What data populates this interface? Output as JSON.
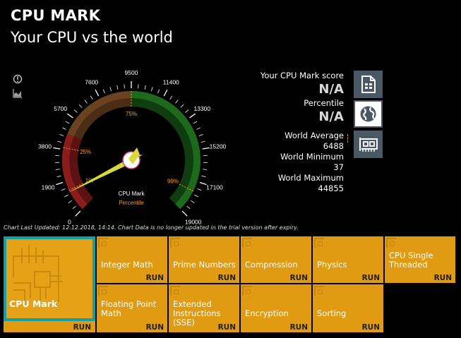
{
  "header": {
    "title": "CPU MARK",
    "subtitle": "Your CPU vs the world"
  },
  "gauge": {
    "min": 0,
    "max": 19000,
    "ticks": [
      0,
      1900,
      3800,
      5700,
      7600,
      9500,
      11400,
      13300,
      15200,
      17100,
      19000
    ],
    "bands": [
      {
        "from": 0,
        "to": 4750,
        "color": "#5c1212"
      },
      {
        "from": 4750,
        "to": 9500,
        "color": "#4a2d14"
      },
      {
        "from": 9500,
        "to": 19000,
        "color": "#0f3d0f"
      }
    ],
    "band_accents": [
      {
        "from": 0,
        "to": 4750,
        "color": "#8a1c1c"
      },
      {
        "from": 4750,
        "to": 9500,
        "color": "#6a4220"
      },
      {
        "from": 9500,
        "to": 19000,
        "color": "#1d6a1d"
      }
    ],
    "percent_markers": [
      {
        "label": "1%",
        "value": 1350
      },
      {
        "label": "25%",
        "value": 3900
      },
      {
        "label": "75%",
        "value": 9500
      },
      {
        "label": "99%",
        "value": 17700
      }
    ],
    "needle_value": 1250,
    "needle_color": "#d8d838",
    "center_label": "CPU Mark",
    "center_sublabel": "Percentile",
    "tick_color": "#ffffff",
    "marker_color": "#f0a020"
  },
  "stats": {
    "score_label": "Your CPU Mark score",
    "score_value": "N/A",
    "percentile_label": "Percentile",
    "percentile_value": "N/A",
    "world_avg_label": "World Average",
    "world_avg_value": "6488",
    "world_min_label": "World Minimum",
    "world_min_value": "37",
    "world_max_label": "World Maximum",
    "world_max_value": "44855"
  },
  "side_icons": [
    {
      "name": "info-icon"
    },
    {
      "name": "chart-icon"
    }
  ],
  "icon_buttons": [
    {
      "name": "document-icon",
      "selected": false
    },
    {
      "name": "globe-icon",
      "selected": true
    },
    {
      "name": "network-card-icon",
      "selected": false
    }
  ],
  "footnote": "Chart Last Updated: 12.12.2018, 14:14. Chart Data is no longer updated in the trial version after expiry.",
  "main_tile": {
    "label": "CPU Mark",
    "run": "RUN"
  },
  "tiles": [
    {
      "label": "Integer Math",
      "run": "RUN"
    },
    {
      "label": "Prime Numbers",
      "run": "RUN"
    },
    {
      "label": "Compression",
      "run": "RUN"
    },
    {
      "label": "Physics",
      "run": "RUN"
    },
    {
      "label": "CPU Single Threaded",
      "run": "RUN"
    },
    {
      "label": "Floating Point Math",
      "run": "RUN"
    },
    {
      "label": "Extended Instructions (SSE)",
      "run": "RUN"
    },
    {
      "label": "Encryption",
      "run": "RUN"
    },
    {
      "label": "Sorting",
      "run": "RUN"
    }
  ]
}
